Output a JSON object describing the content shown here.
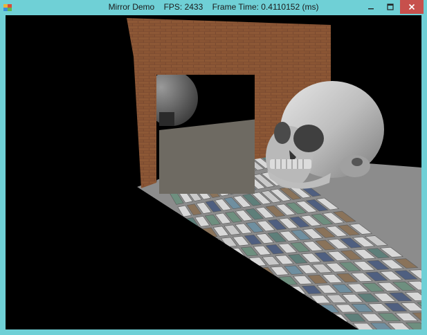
{
  "window": {
    "title": "Mirror Demo    FPS: 2433    Frame Time: 0.4110152 (ms)",
    "icon": "app-icon",
    "controls": [
      "minimize-icon",
      "maximize-icon",
      "close-icon"
    ],
    "colors": {
      "frame": "#6fd0d6",
      "close": "#c7504c",
      "background": "#000000"
    }
  },
  "scene": {
    "objects": [
      "brick-wall-with-mirror-opening",
      "reflected-skull",
      "checkered-tile-floor",
      "skull"
    ]
  }
}
